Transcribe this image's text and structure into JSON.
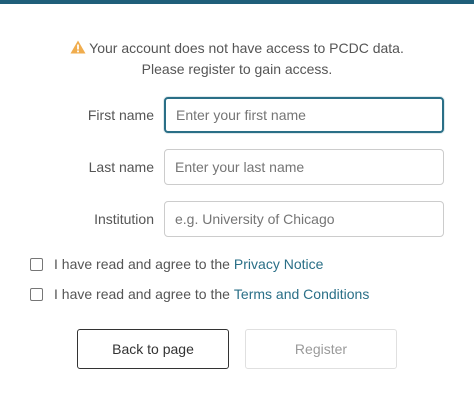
{
  "colors": {
    "accent": "#1f5f7a",
    "link": "#2a6f87",
    "warning": "#f0ad4e"
  },
  "warning": {
    "icon": "warning-triangle-icon",
    "line1": "Your account does not have access to PCDC data.",
    "line2": "Please register to gain access."
  },
  "form": {
    "first_name": {
      "label": "First name",
      "placeholder": "Enter your first name",
      "value": ""
    },
    "last_name": {
      "label": "Last name",
      "placeholder": "Enter your last name",
      "value": ""
    },
    "institution": {
      "label": "Institution",
      "placeholder": "e.g. University of Chicago",
      "value": ""
    }
  },
  "agreements": {
    "privacy": {
      "text": "I have read and agree to the",
      "link": "Privacy Notice",
      "checked": false
    },
    "terms": {
      "text": "I have read and agree to the",
      "link": "Terms and Conditions",
      "checked": false
    }
  },
  "buttons": {
    "back": "Back to page",
    "register": "Register"
  }
}
